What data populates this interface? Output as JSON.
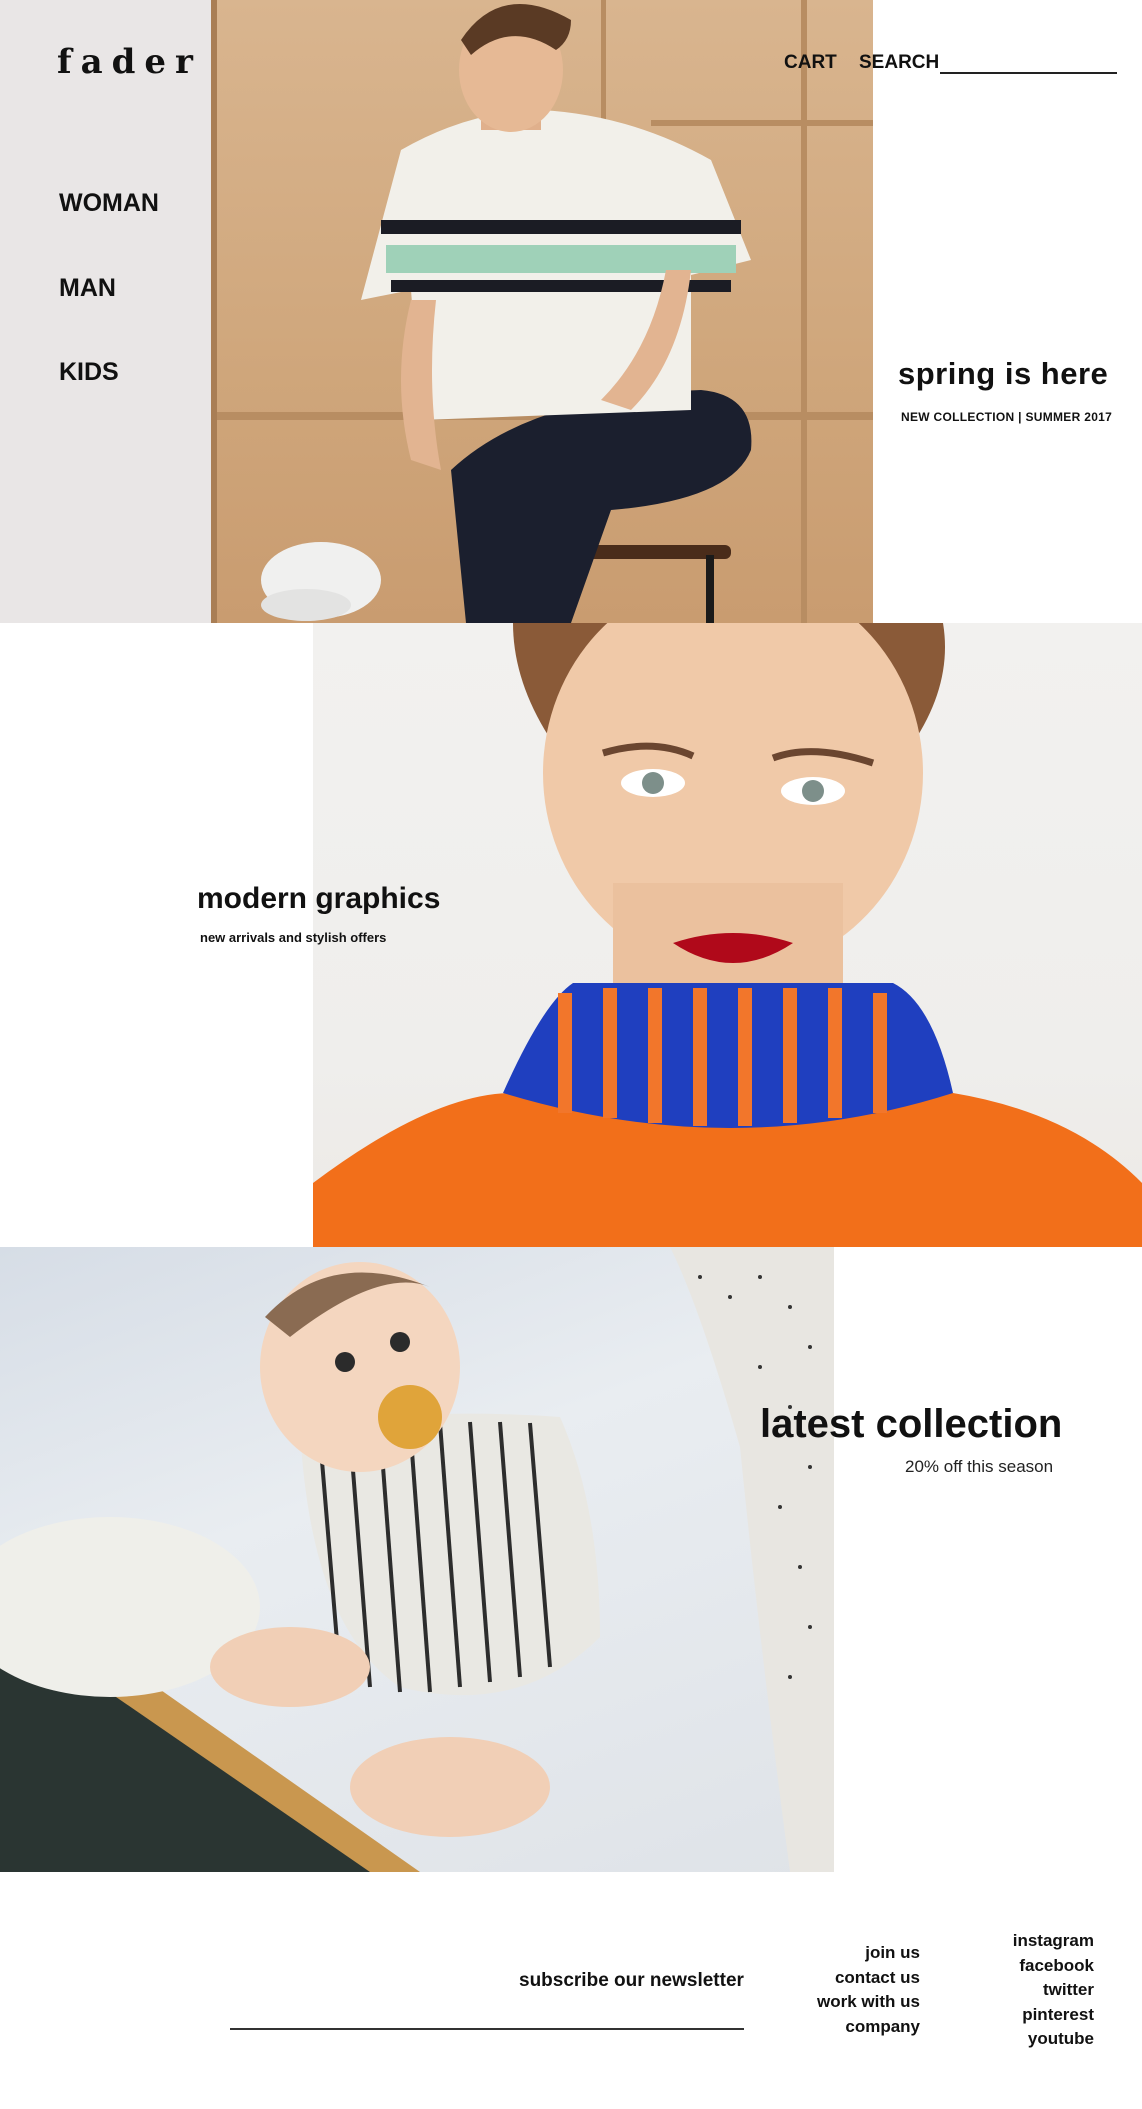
{
  "brand": {
    "logo": "fader"
  },
  "nav": {
    "items": [
      "WOMAN",
      "MAN",
      "KIDS"
    ]
  },
  "topbar": {
    "cart": "CART",
    "search": "SEARCH",
    "search_value": ""
  },
  "sections": [
    {
      "title": "spring is here",
      "subtitle": "NEW COLLECTION | SUMMER 2017"
    },
    {
      "title": "modern graphics",
      "subtitle": "new arrivals and stylish offers"
    },
    {
      "title": "latest collection",
      "subtitle": "20% off this season"
    }
  ],
  "footer": {
    "newsletter_label": "subscribe our newsletter",
    "newsletter_value": "",
    "links_col1": [
      "join us",
      "contact us",
      "work with us",
      "company"
    ],
    "links_col2": [
      "instagram",
      "facebook",
      "twitter",
      "pinterest",
      "youtube"
    ]
  }
}
